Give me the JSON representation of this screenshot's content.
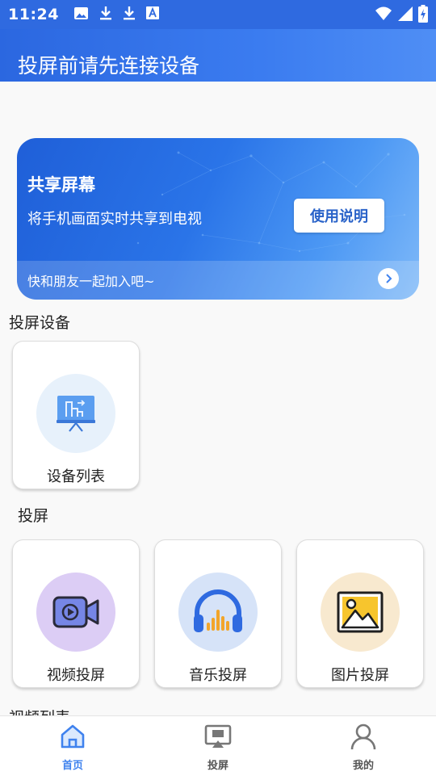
{
  "status_bar": {
    "time": "11:24",
    "icons_left": [
      "image-icon",
      "download-icon",
      "download-icon",
      "font-icon"
    ],
    "icons_right": [
      "wifi-icon",
      "signal-icon",
      "battery-charging-icon"
    ]
  },
  "app_bar": {
    "title": "投屏前请先连接设备"
  },
  "banner": {
    "title": "共享屏幕",
    "subtitle": "将手机画面实时共享到电视",
    "button_label": "使用说明",
    "footer_text": "快和朋友一起加入吧~"
  },
  "devices_section": {
    "title": "投屏设备",
    "cards": [
      {
        "label": "设备列表",
        "icon": "device-screen-icon"
      }
    ]
  },
  "cast_section": {
    "title": "投屏",
    "cards": [
      {
        "label": "视频投屏",
        "icon": "video-camera-icon"
      },
      {
        "label": "音乐投屏",
        "icon": "headphones-icon"
      },
      {
        "label": "图片投屏",
        "icon": "picture-icon"
      }
    ]
  },
  "video_list_section": {
    "title": "视频列表"
  },
  "bottom_nav": {
    "items": [
      {
        "label": "首页",
        "icon": "home-icon",
        "active": true
      },
      {
        "label": "投屏",
        "icon": "cast-icon",
        "active": false
      },
      {
        "label": "我的",
        "icon": "user-icon",
        "active": false
      }
    ]
  },
  "colors": {
    "primary": "#2f6ae0",
    "nav_active": "#3f82ee",
    "nav_inactive": "#777777",
    "card_bg": "#ffffff",
    "page_bg": "#f9f9f9"
  }
}
